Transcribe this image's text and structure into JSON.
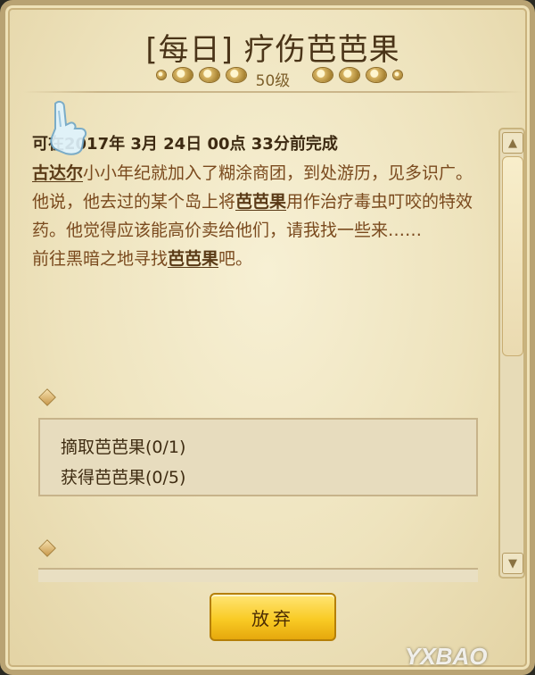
{
  "header": {
    "title": "[每日] 疗伤芭芭果",
    "level": "50级"
  },
  "quest": {
    "date_line": "可在2017年 3月 24日 00点 33分前完成",
    "p1_link": "古达尔",
    "p1_text": "小小年纪就加入了糊涂商团，到处游历，见多识广。",
    "p2_pre": "他说，他去过的某个岛上将",
    "p2_link": "芭芭果",
    "p2_post": "用作治疗毒虫叮咬的特效药。他觉得应该能高价卖给他们，请我找一些来……",
    "p3_pre": "前往黑暗之地寻找",
    "p3_link": "芭芭果",
    "p3_post": "吧。"
  },
  "objectives": [
    "摘取芭芭果(0/1)",
    "获得芭芭果(0/5)"
  ],
  "footer": {
    "abandon_label": "放弃"
  },
  "watermark": "YXBAO",
  "icons": {
    "cursor": "pointing-hand-icon",
    "scroll_up": "triangle-up-icon",
    "scroll_down": "triangle-down-icon"
  },
  "colors": {
    "parchment": "#f3eacb",
    "text_brown": "#7a4a1e",
    "button_gold": "#f9cb25"
  }
}
